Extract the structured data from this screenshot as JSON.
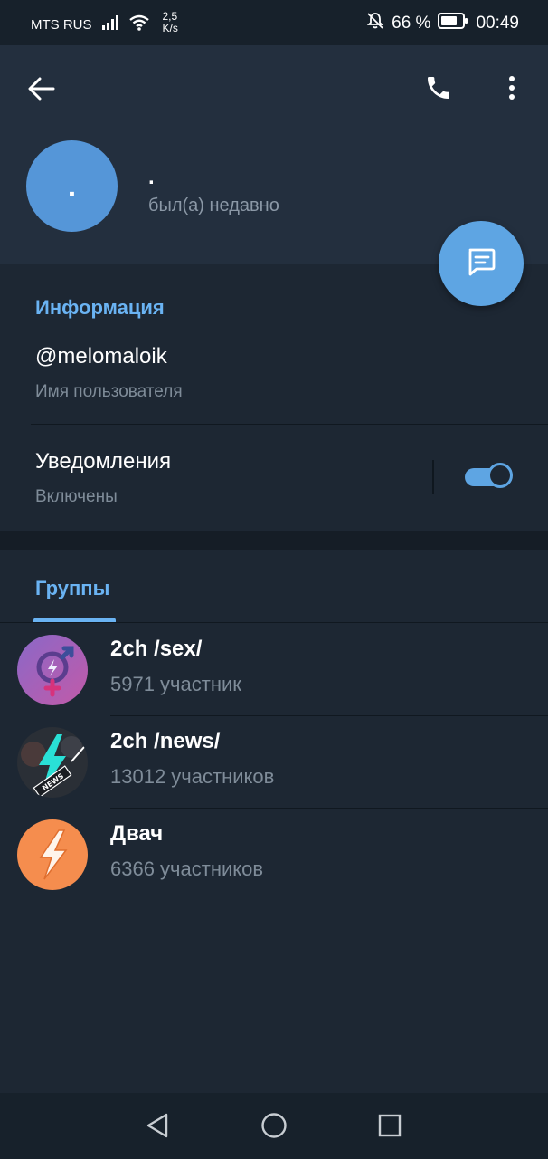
{
  "status_bar": {
    "carrier": "MTS RUS",
    "speed_value": "2,5",
    "speed_unit": "K/s",
    "battery": "66 %",
    "time": "00:49"
  },
  "profile": {
    "avatar_letter": ".",
    "name": ".",
    "status": "был(а) недавно"
  },
  "info": {
    "title": "Информация",
    "username": "@melomaloik",
    "username_caption": "Имя пользователя",
    "notifications_label": "Уведомления",
    "notifications_value": "Включены",
    "notifications_enabled": true
  },
  "groups": {
    "tab_label": "Группы",
    "items": [
      {
        "name": "2ch /sex/",
        "members": "5971 участник",
        "icon": "gender-symbol-avatar"
      },
      {
        "name": "2ch /news/",
        "members": "13012 участников",
        "icon": "news-lightning-avatar"
      },
      {
        "name": "Двач",
        "members": "6366 участников",
        "icon": "lightning-avatar"
      }
    ]
  },
  "icons": {
    "back": "arrow-left-icon",
    "call": "phone-icon",
    "menu": "more-vertical-icon",
    "fab": "message-icon",
    "nav_back": "triangle-back-icon",
    "nav_home": "circle-home-icon",
    "nav_recent": "square-recent-icon"
  },
  "colors": {
    "accent": "#5ea5e3",
    "header_bg": "#232f3e",
    "page_bg": "#1d2733",
    "link_blue": "#6ab3f3"
  }
}
